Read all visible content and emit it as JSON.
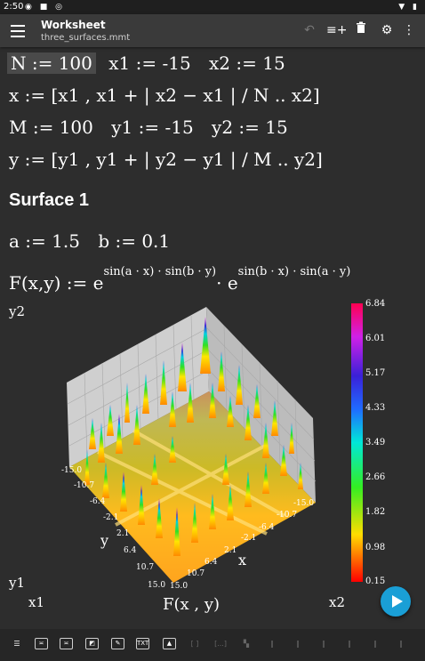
{
  "status": {
    "time": "2:50"
  },
  "appbar": {
    "title": "Worksheet",
    "subtitle": "three_surfaces.mmt"
  },
  "lines": {
    "l1": {
      "N": "N := 100",
      "x1": "x1 := -15",
      "x2": "x2 := 15"
    },
    "l2": {
      "text": "x := [x1 , x1 + | x2 − x1 | / N .. x2]"
    },
    "l3": {
      "M": "M := 100",
      "y1": "y1 := -15",
      "y2": "y2 := 15"
    },
    "l4": {
      "text": "y := [y1 , y1 + | y2 − y1 | / M .. y2]"
    },
    "heading": "Surface 1",
    "l5": {
      "a": "a := 1.5",
      "b": "b := 0.1"
    },
    "l6": {
      "lhs": "F(x,y) := e",
      "exp1": "sin(a · x) · sin(b · y)",
      "dot": "· e",
      "exp2": "sin(b · x) · sin(a · y)"
    }
  },
  "plot": {
    "y2": "y2",
    "y1": "y1",
    "x1": "x1",
    "x2": "x2",
    "axis_x": "x",
    "axis_y": "y",
    "caption": "F(x , y)",
    "y_ticks": [
      "-15.0",
      "-10.7",
      "-6.4",
      "-2.1",
      "2.1",
      "6.4",
      "10.7",
      "15.0"
    ],
    "x_ticks": [
      "15.0",
      "10.7",
      "6.4",
      "2.1",
      "-2.1",
      "-6.4",
      "-10.7",
      "-15.0"
    ],
    "colorbar": [
      "6.84",
      "6.01",
      "5.17",
      "4.33",
      "3.49",
      "2.66",
      "1.82",
      "0.98",
      "0.15"
    ]
  },
  "colors": {
    "background": "#2d2d2d",
    "appbar": "#3a3a3a",
    "fab": "#1a9fd6"
  },
  "bottom_tools": [
    "list-icon",
    "equation-icon",
    "equation-box-icon",
    "image-icon",
    "pen-icon",
    "txt-icon",
    "chart-icon",
    "bracket-icon",
    "dots-icon",
    "block-icon",
    "pipe-icon",
    "pipe2-icon",
    "pipe3-icon",
    "pipe4-icon",
    "pipe5-icon",
    "pipe6-icon"
  ],
  "bottom_txt": "TXT"
}
